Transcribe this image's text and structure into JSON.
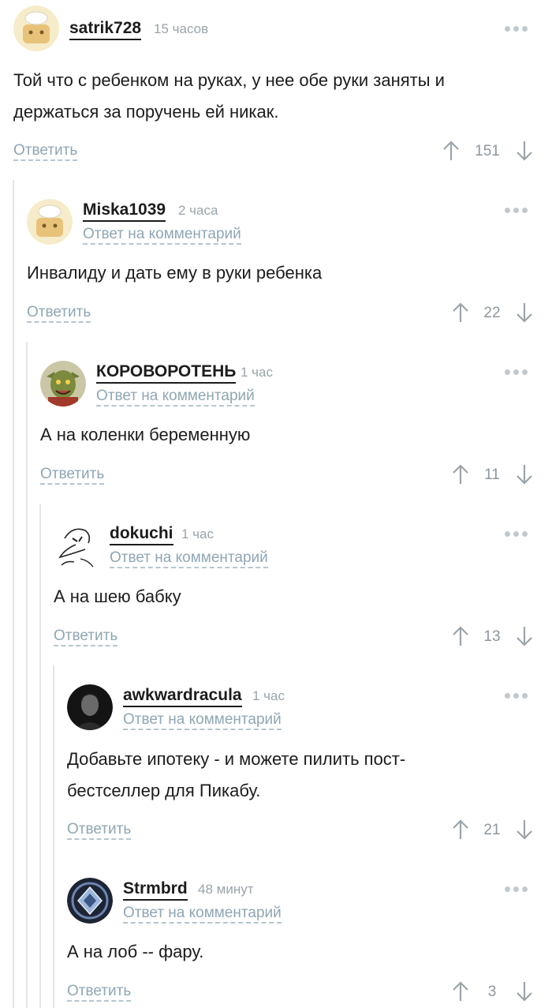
{
  "reply_to_label": "Ответ на комментарий",
  "answer_label": "Ответить",
  "comments": [
    {
      "user": "satrik728",
      "time": "15 часов",
      "text_lines": [
        "Той что с ребенком на руках, у нее обе руки заняты и",
        "держаться за поручень ей никак."
      ],
      "rating": "151",
      "avatar_icon": "cookie-chef-avatar-icon"
    },
    {
      "user": "Miska1039",
      "time": "2 часа",
      "text_lines": [
        "Инвалиду и дать ему в руки ребенка"
      ],
      "rating": "22",
      "avatar_icon": "cookie-chef-avatar-icon"
    },
    {
      "user": "КОРОВОРОТЕНЬ",
      "time": "1 час",
      "text_lines": [
        "А на коленки беременную"
      ],
      "rating": "11",
      "avatar_icon": "goblin-avatar-icon"
    },
    {
      "user": "dokuchi",
      "time": "1 час",
      "text_lines": [
        "А на шею бабку"
      ],
      "rating": "13",
      "avatar_icon": "duck-sketch-avatar-icon"
    },
    {
      "user": "awkwardracula",
      "time": "1 час",
      "text_lines": [
        "Добавьте ипотеку - и можете пилить пост-",
        "бестселлер для Пикабу."
      ],
      "rating": "21",
      "avatar_icon": "dark-portrait-avatar-icon"
    },
    {
      "user": "Strmbrd",
      "time": "48 минут",
      "text_lines": [
        "А на лоб -- фару."
      ],
      "rating": "3",
      "avatar_icon": "rank-badge-avatar-icon"
    }
  ]
}
